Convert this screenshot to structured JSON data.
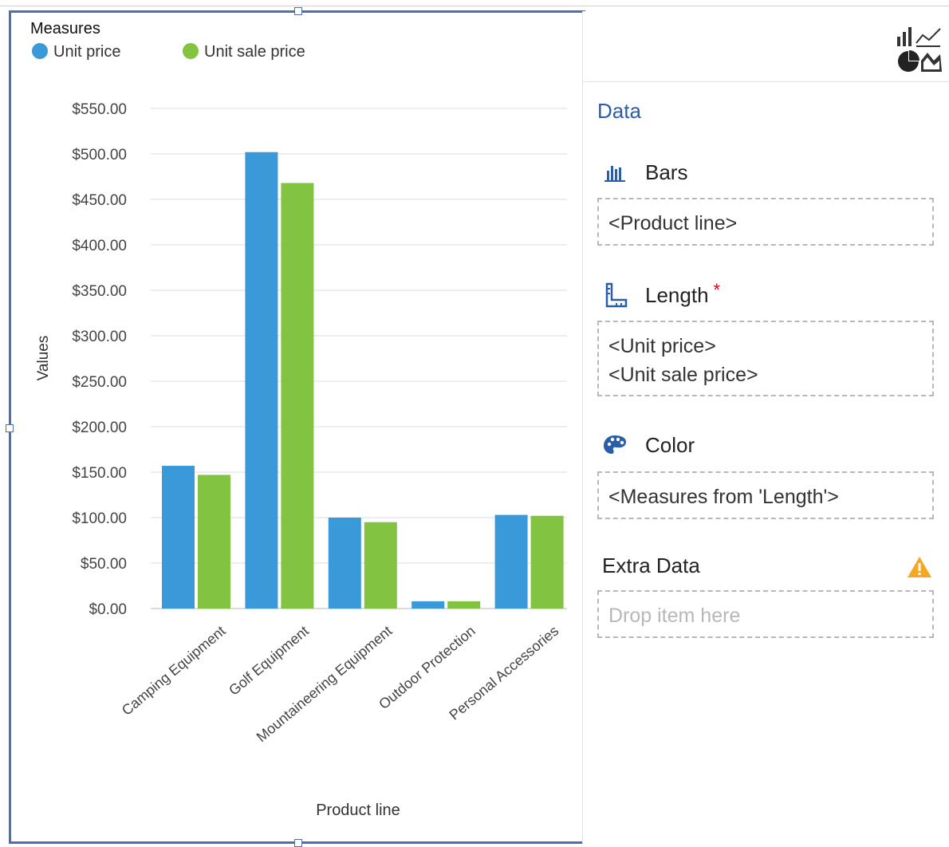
{
  "colors": {
    "unit_price": "#3a9ad9",
    "unit_sale_price": "#82c341",
    "panel_heading": "#2a5ea8",
    "selection_border": "#4a6fb5",
    "warning": "#f5a623"
  },
  "chart": {
    "legend_title": "Measures",
    "legend_items": [
      {
        "label": "Unit price",
        "color": "#3a9ad9"
      },
      {
        "label": "Unit sale price",
        "color": "#82c341"
      }
    ],
    "y_axis_title": "Values",
    "x_axis_title": "Product line"
  },
  "chart_data": {
    "type": "bar",
    "categories": [
      "Camping Equipment",
      "Golf Equipment",
      "Mountaineering Equipment",
      "Outdoor Protection",
      "Personal Accessories"
    ],
    "series": [
      {
        "name": "Unit price",
        "values": [
          157,
          502,
          100,
          8,
          103
        ]
      },
      {
        "name": "Unit sale price",
        "values": [
          147,
          468,
          95,
          8,
          102
        ]
      }
    ],
    "ylim": [
      0,
      550
    ],
    "y_ticks": [
      0,
      50,
      100,
      150,
      200,
      250,
      300,
      350,
      400,
      450,
      500,
      550
    ],
    "y_tick_labels": [
      "$0.00",
      "$50.00",
      "$100.00",
      "$150.00",
      "$200.00",
      "$250.00",
      "$300.00",
      "$350.00",
      "$400.00",
      "$450.00",
      "$500.00",
      "$550.00"
    ],
    "xlabel": "Product line",
    "ylabel": "Values",
    "legend_title": "Measures",
    "legend_position": "top-left",
    "grid": true
  },
  "panel": {
    "heading": "Data",
    "viz_type_icon": "chart-type-icon",
    "slots": {
      "bars": {
        "title": "Bars",
        "icon": "bar-chart-icon",
        "items": [
          "<Product line>"
        ]
      },
      "length": {
        "title": "Length",
        "required_mark": "*",
        "icon": "ruler-icon",
        "items": [
          "<Unit price>",
          "<Unit sale price>"
        ]
      },
      "color": {
        "title": "Color",
        "icon": "palette-icon",
        "items": [
          "<Measures from 'Length'>"
        ]
      },
      "extra": {
        "title": "Extra Data",
        "icon": "warning-icon",
        "placeholder": "Drop item here"
      }
    }
  }
}
